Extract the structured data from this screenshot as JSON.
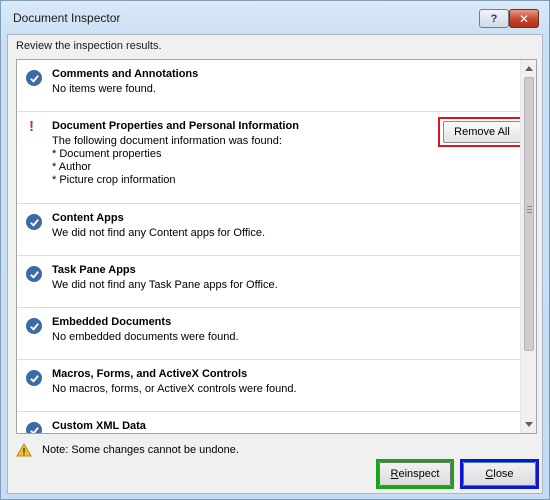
{
  "window": {
    "title": "Document Inspector",
    "help_label": "?",
    "close_label": "✕"
  },
  "subtitle": "Review the inspection results.",
  "items": [
    {
      "status": "ok",
      "title": "Comments and Annotations",
      "lines": [
        "No items were found."
      ]
    },
    {
      "status": "warning",
      "title": "Document Properties and Personal Information",
      "lines": [
        "The following document information was found:",
        "* Document properties",
        "* Author",
        "* Picture crop information"
      ],
      "action": "Remove All"
    },
    {
      "status": "ok",
      "title": "Content Apps",
      "lines": [
        "We did not find any Content apps for Office."
      ]
    },
    {
      "status": "ok",
      "title": "Task Pane Apps",
      "lines": [
        "We did not find any Task Pane apps for Office."
      ]
    },
    {
      "status": "ok",
      "title": "Embedded Documents",
      "lines": [
        "No embedded documents were found."
      ]
    },
    {
      "status": "ok",
      "title": "Macros, Forms, and ActiveX Controls",
      "lines": [
        "No macros, forms, or ActiveX controls were found."
      ]
    },
    {
      "status": "ok",
      "title": "Custom XML Data",
      "lines": []
    }
  ],
  "note": "Note: Some changes cannot be undone.",
  "buttons": {
    "reinspect": {
      "label": "Reinspect",
      "mnemonic": "R",
      "rest": "einspect"
    },
    "close": {
      "label": "Close",
      "mnemonic": "C",
      "rest": "lose"
    }
  },
  "colors": {
    "ok_icon": "#3d6ca3",
    "warning_mark": "#c0392b",
    "highlight_red": "#e3131b",
    "highlight_green": "#19a319",
    "highlight_blue": "#0a18d6"
  }
}
